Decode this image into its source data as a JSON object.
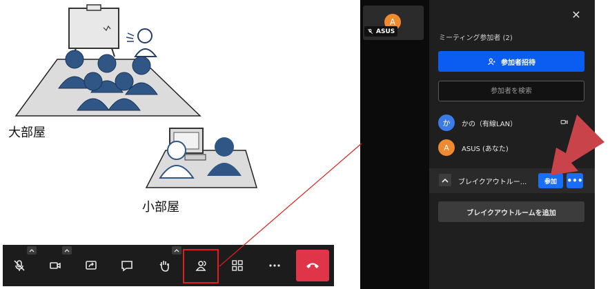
{
  "illustration": {
    "big_room_label": "大部屋",
    "small_room_label": "小部屋"
  },
  "toolbar": {
    "buttons": [
      {
        "icon": "mic-muted-icon",
        "has_caret": true
      },
      {
        "icon": "camera-icon",
        "has_caret": true
      },
      {
        "icon": "share-screen-icon",
        "has_caret": false
      },
      {
        "icon": "chat-icon",
        "has_caret": false
      },
      {
        "icon": "raise-hand-icon",
        "has_caret": true
      },
      {
        "icon": "participants-icon",
        "has_caret": false,
        "highlighted": true
      },
      {
        "icon": "grid-view-icon",
        "has_caret": false
      },
      {
        "icon": "more-icon",
        "has_caret": false
      },
      {
        "icon": "hangup-icon",
        "has_caret": false
      }
    ],
    "highlight_color": "#e0201c",
    "hangup_color": "#e03448"
  },
  "video_tile": {
    "avatar_letter": "A",
    "name": "ASUS",
    "avatar_color": "#f08a30"
  },
  "panel": {
    "close_label": "✕",
    "title": "ミーティング参加者 (2)",
    "invite_label": "参加者招待",
    "search_placeholder": "参加者を検索",
    "accent": "#0b5cf0",
    "participants": [
      {
        "avatar_letter": "か",
        "name": "かの（有線LAN）",
        "avatar_color": "#3b7be8"
      },
      {
        "avatar_letter": "A",
        "name": "ASUS (あなた)",
        "avatar_color": "#f08a30"
      }
    ],
    "breakout": {
      "name": "ブレイクアウトルー...",
      "join_label": "参加",
      "more_label": "•••"
    },
    "add_room_label": "ブレイクアウトルームを追加"
  },
  "annotations": {
    "arrow_color": "#c8434a",
    "line_color": "#e0201c"
  }
}
